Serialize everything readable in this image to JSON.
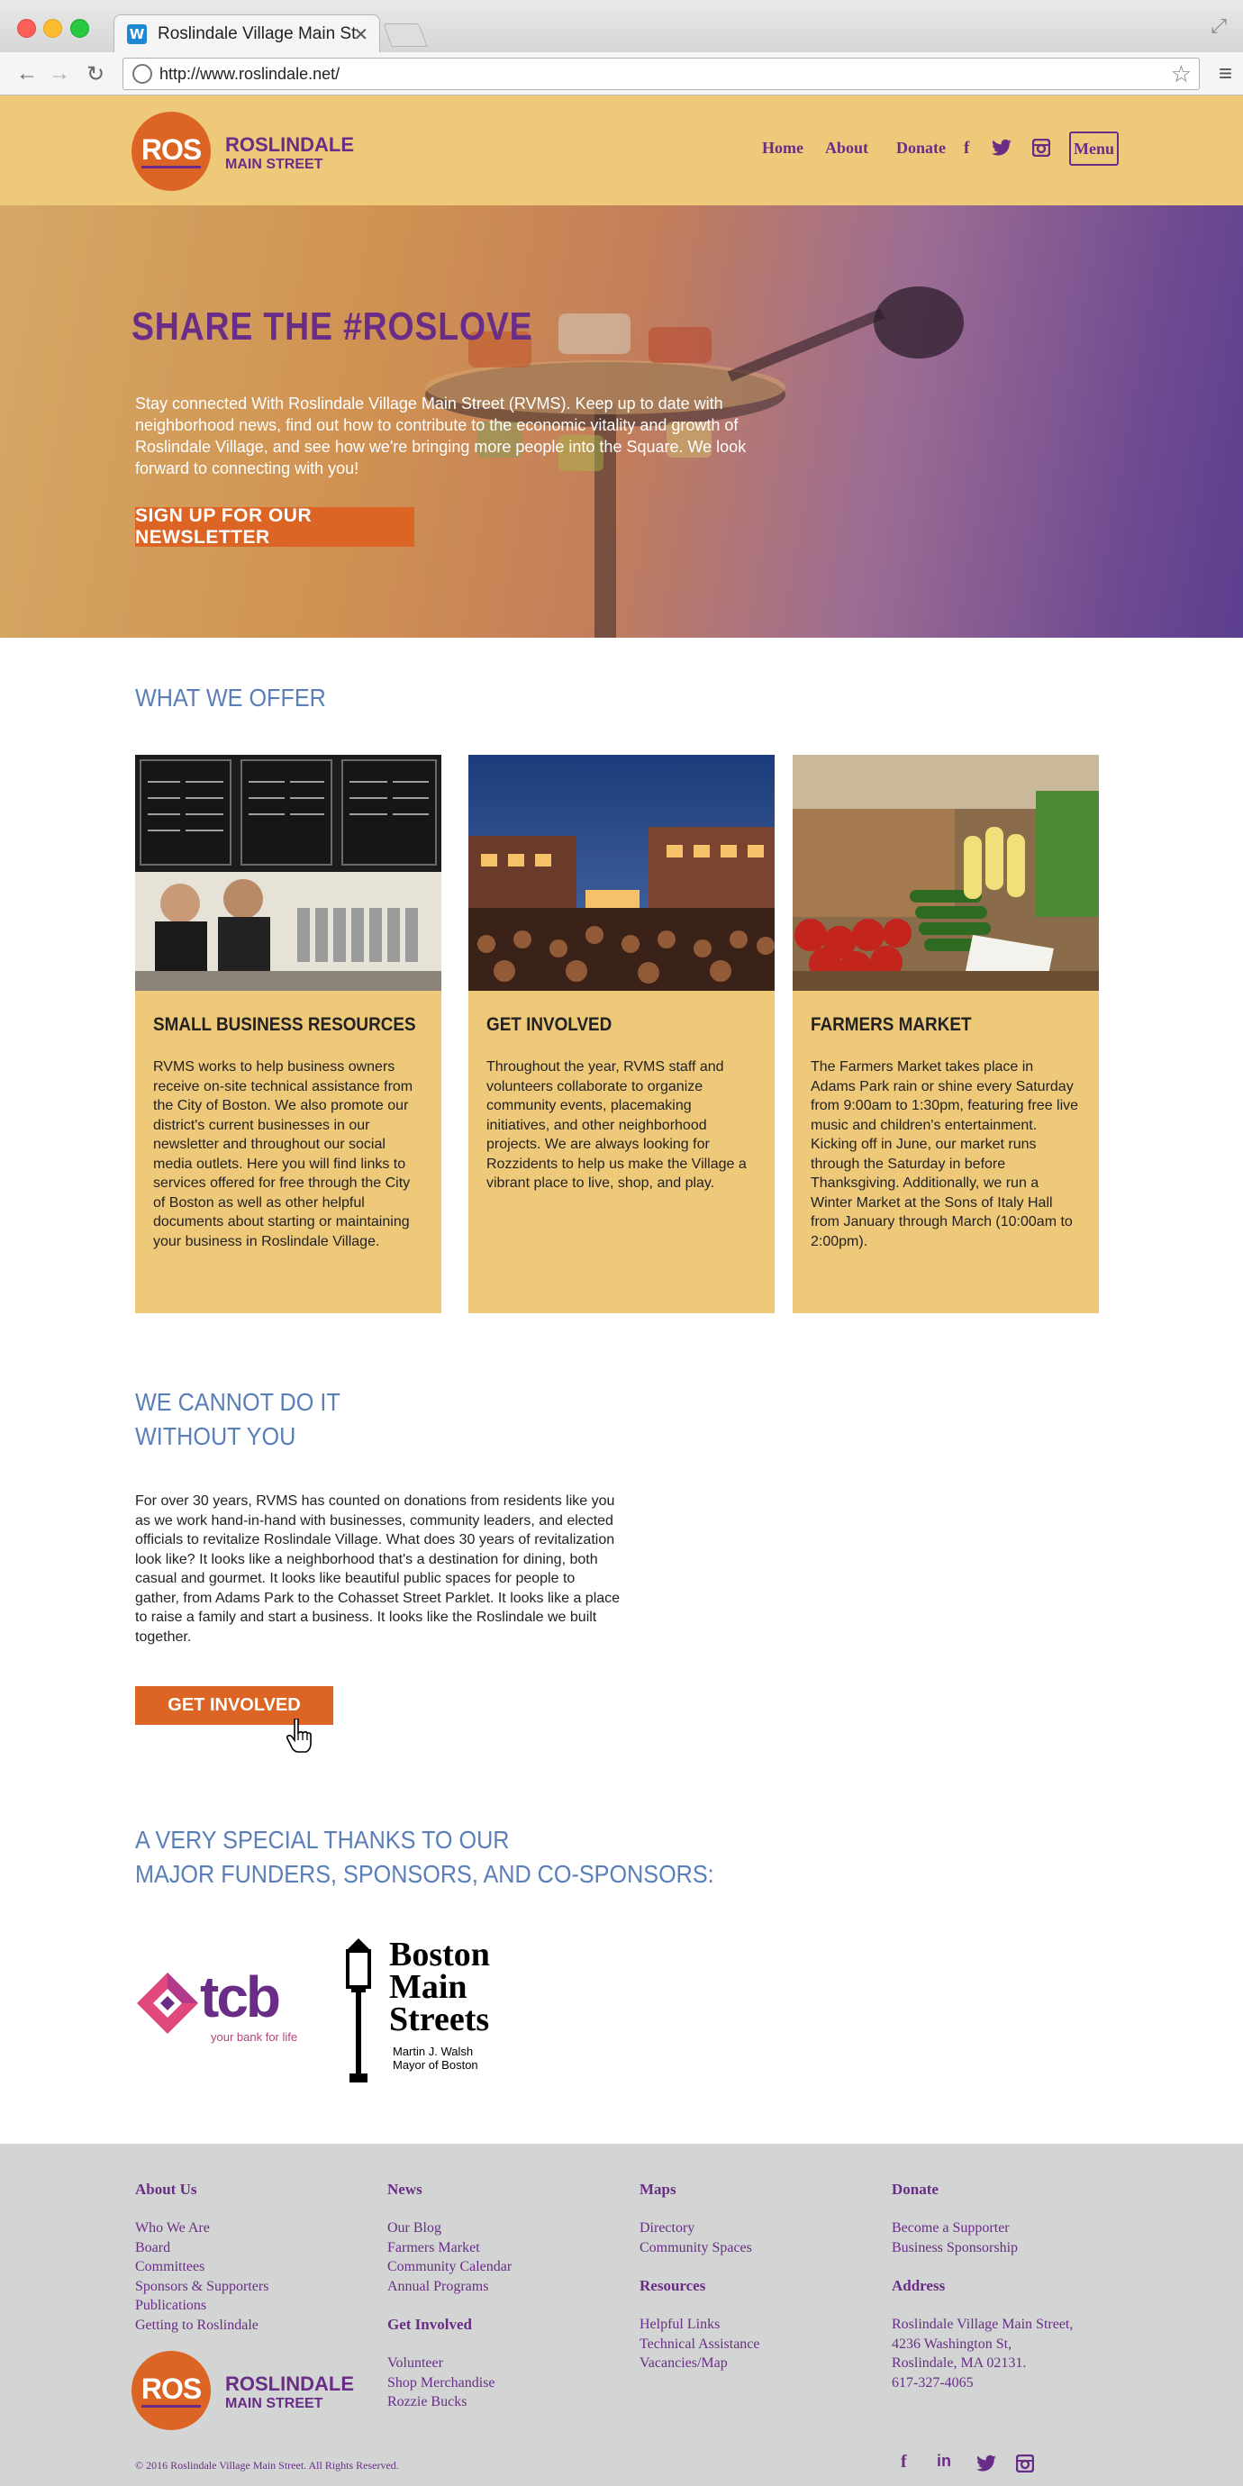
{
  "browser": {
    "tab_title": "Roslindale Village Main St",
    "url": "http://www.roslindale.net/",
    "favicon": "W"
  },
  "header": {
    "logo_mark": "ROS",
    "logo_name": "ROSLINDALE",
    "logo_sub": "MAIN STREET",
    "nav": {
      "home": "Home",
      "about": "About",
      "donate": "Donate",
      "menu": "Menu"
    }
  },
  "hero": {
    "title": "SHARE THE #ROSLOVE",
    "text": "Stay connected With Roslindale Village Main Street (RVMS). Keep up to date with neighborhood news, find out how to contribute to the economic vitality and growth of Roslindale Village, and see how we're bringing more people into the Square. We look forward to connecting with you!",
    "button": "SIGN UP FOR OUR NEWSLETTER"
  },
  "offer": {
    "heading": "WHAT WE OFFER",
    "cards": [
      {
        "title": "SMALL BUSINESS RESOURCES",
        "body": "RVMS works to help business owners receive on-site technical assistance from the City of Boston. We also promote our district's current businesses in our newsletter and throughout our social media outlets. Here you will find links to services offered for free through the City of Boston as well as other helpful documents about starting or maintaining your business in Roslindale Village."
      },
      {
        "title": "GET INVOLVED",
        "body": "Throughout the year, RVMS staff and volunteers collaborate to organize community events, placemaking initiatives, and other neighborhood projects. We are always looking for Rozzidents to  help us make the Village a vibrant place to live, shop, and play."
      },
      {
        "title": "FARMERS MARKET",
        "body": "The Farmers Market takes place in Adams Park rain or shine every Saturday from 9:00am to 1:30pm, featuring free live music and children's entertainment. Kicking off in June, our market runs through the Saturday in before Thanksgiving. Additionally, we run a Winter Market at the Sons of Italy Hall from January through March (10:00am to 2:00pm)."
      }
    ]
  },
  "donate_section": {
    "heading_line1": "WE CANNOT DO IT",
    "heading_line2": "WITHOUT YOU",
    "text": "For over 30 years, RVMS has counted on donations from residents like you as we work hand-in-hand with businesses, community leaders, and elected officials to revitalize Roslindale Village. What does 30 years of revitalization look like? It looks like a neighborhood that's a destination for dining, both casual and gourmet. It looks like beautiful public spaces for people to gather, from Adams Park to the Cohasset Street Parklet. It looks like a place to raise a family and start a business. It looks like the Roslindale we built together.",
    "button": "GET INVOLVED"
  },
  "sponsors": {
    "heading_line1": "A VERY SPECIAL THANKS TO OUR",
    "heading_line2": "MAJOR FUNDERS, SPONSORS, AND CO-SPONSORS:",
    "tcb_name": "tcb",
    "tcb_tagline": "your bank for life",
    "bms_line1": "Boston",
    "bms_line2": "Main",
    "bms_line3": "Streets",
    "bms_line4": "Martin J. Walsh",
    "bms_line5": "Mayor of Boston"
  },
  "footer": {
    "about": {
      "head": "About Us",
      "links": [
        "Who We Are",
        "Board",
        "Committees",
        "Sponsors & Supporters",
        "Publications",
        "Getting to Roslindale"
      ]
    },
    "news": {
      "head": "News",
      "links": [
        "Our Blog",
        "Farmers Market",
        "Community Calendar",
        "Annual Programs"
      ]
    },
    "involved": {
      "head": "Get Involved",
      "links": [
        "Volunteer",
        "Shop Merchandise",
        "Rozzie Bucks"
      ]
    },
    "maps": {
      "head": "Maps",
      "links": [
        "Directory",
        "Community Spaces"
      ]
    },
    "resources": {
      "head": "Resources",
      "links": [
        "Helpful Links",
        "Technical Assistance",
        "Vacancies/Map"
      ]
    },
    "donate": {
      "head": "Donate",
      "links": [
        "Become a Supporter",
        "Business Sponsorship"
      ]
    },
    "address": {
      "head": "Address",
      "lines": [
        "Roslindale Village Main Street,",
        "4236 Washington St,",
        "Roslindale, MA 02131.",
        "617-327-4065"
      ]
    },
    "logo_mark": "ROS",
    "logo_name": "ROSLINDALE",
    "logo_sub": "MAIN STREET",
    "copyright": "© 2016 Roslindale Village Main Street. All Rights Reserved."
  },
  "colors": {
    "header_bg": "#efc97a",
    "brand_purple": "#6a2d87",
    "brand_orange": "#dc6424",
    "heading_blue": "#5a7fb8",
    "footer_bg": "#d2d5d3"
  }
}
